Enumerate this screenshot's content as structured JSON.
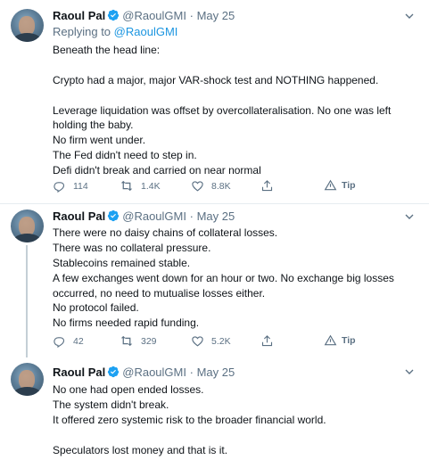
{
  "tweets": [
    {
      "author_name": "Raoul Pal",
      "author_handle": "@RaoulGMI",
      "separator": "·",
      "date": "May 25",
      "replying_prefix": "Replying to",
      "replying_to": "@RaoulGMI",
      "lines": [
        "Beneath the head line:",
        "",
        "Crypto had a major, major VAR-shock test and NOTHING happened.",
        "",
        "Leverage liquidation was offset by overcollateralisation. No one was left",
        "holding the baby.",
        "No firm went under.",
        "The Fed didn't need to step in.",
        "Defi didn't break and carried on near normal"
      ],
      "replies": "114",
      "retweets": "1.4K",
      "likes": "8.8K",
      "tip_label": "Tip"
    },
    {
      "author_name": "Raoul Pal",
      "author_handle": "@RaoulGMI",
      "separator": "·",
      "date": "May 25",
      "lines": [
        "There were no daisy chains of collateral losses.",
        "There was no collateral pressure.",
        "Stablecoins remained stable.",
        "A few exchanges went down for an hour or two. No exchange big losses",
        "occurred, no need to mutualise losses either.",
        "No protocol failed.",
        "No firms needed rapid funding."
      ],
      "replies": "42",
      "retweets": "329",
      "likes": "5.2K",
      "tip_label": "Tip"
    },
    {
      "author_name": "Raoul Pal",
      "author_handle": "@RaoulGMI",
      "separator": "·",
      "date": "May 25",
      "lines": [
        "No one had open ended losses.",
        "The system didn't break.",
        "It offered zero systemic risk to the broader financial world.",
        "",
        "Speculators lost money and that is it."
      ]
    }
  ],
  "colors": {
    "text": "#0f1419",
    "secondary": "#5b7083",
    "link": "#1b95e0",
    "verified": "#1da1f2",
    "divider": "#e6ecf0"
  },
  "icons": [
    "verified-badge-icon",
    "chevron-down-icon",
    "reply-icon",
    "retweet-icon",
    "like-icon",
    "share-icon",
    "tip-icon"
  ]
}
